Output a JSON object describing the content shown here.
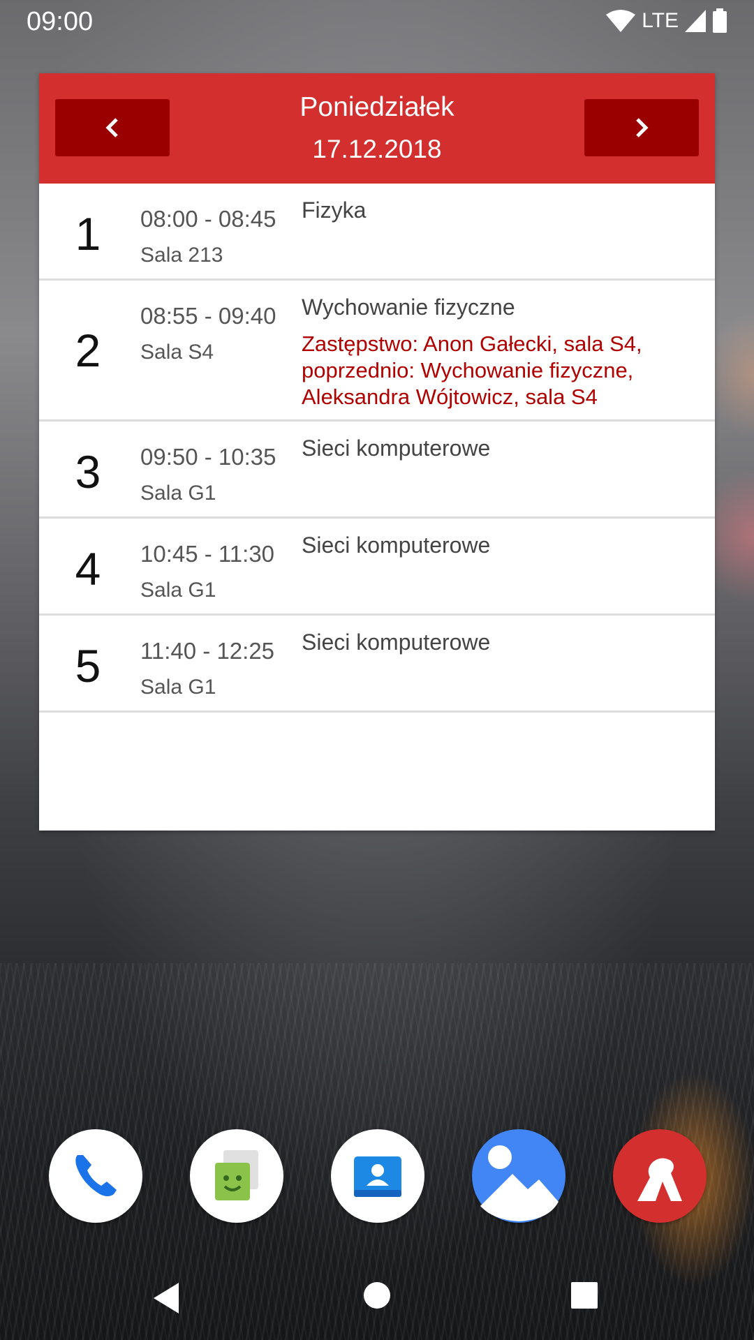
{
  "status_bar": {
    "time": "09:00",
    "network_label": "LTE"
  },
  "widget": {
    "day": "Poniedziałek",
    "date": "17.12.2018",
    "prev_icon": "chevron-left-icon",
    "next_icon": "chevron-right-icon",
    "lessons": [
      {
        "number": "1",
        "time": "08:00 - 08:45",
        "room": "Sala 213",
        "subject": "Fizyka",
        "note": ""
      },
      {
        "number": "2",
        "time": "08:55 - 09:40",
        "room": "Sala S4",
        "subject": "Wychowanie fizyczne",
        "note": "Zastępstwo: Anon Gałecki, sala S4, poprzednio: Wychowanie fizyczne, Aleksandra Wójtowicz, sala S4"
      },
      {
        "number": "3",
        "time": "09:50 - 10:35",
        "room": "Sala G1",
        "subject": "Sieci komputerowe",
        "note": ""
      },
      {
        "number": "4",
        "time": "10:45 - 11:30",
        "room": "Sala G1",
        "subject": "Sieci komputerowe",
        "note": ""
      },
      {
        "number": "5",
        "time": "11:40 - 12:25",
        "room": "Sala G1",
        "subject": "Sieci komputerowe",
        "note": ""
      }
    ]
  },
  "dock": {
    "apps": [
      "phone-icon",
      "messaging-icon",
      "contacts-icon",
      "gallery-icon",
      "school-app-icon"
    ]
  },
  "navigation": {
    "keys": [
      "back-icon",
      "home-icon",
      "recents-icon"
    ]
  },
  "colors": {
    "header": "#d32f2f",
    "nav_button": "#9b0000",
    "note_text": "#b00000"
  }
}
